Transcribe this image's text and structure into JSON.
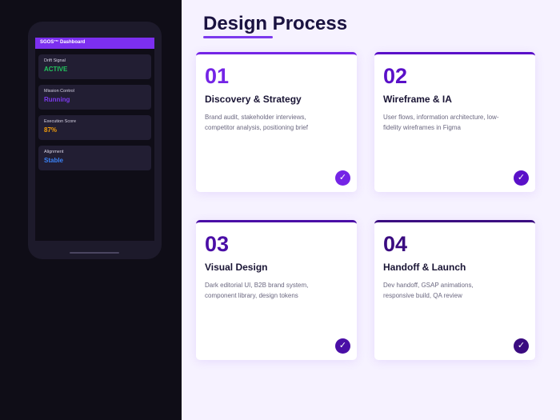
{
  "dashboard": {
    "title": "SGOS™ Dashboard",
    "stats": [
      {
        "label": "Drift Signal",
        "value": "ACTIVE",
        "color": "#22c55e"
      },
      {
        "label": "Mission Control",
        "value": "Running",
        "color": "#7c3aed"
      },
      {
        "label": "Execution Score",
        "value": "87%",
        "color": "#f59e0b"
      },
      {
        "label": "Alignment",
        "value": "Stable",
        "color": "#3b82f6"
      }
    ]
  },
  "heading": "Design Process",
  "cards": [
    {
      "number": "01",
      "title": "Discovery & Strategy",
      "desc": "Brand audit, stakeholder interviews, competitor analysis, positioning brief",
      "color": "#7424e6",
      "icon": "check-icon"
    },
    {
      "number": "02",
      "title": "Wireframe & IA",
      "desc": "User flows, information architecture, low-fidelity wireframes in Figma",
      "color": "#5a10c8",
      "icon": "check-icon"
    },
    {
      "number": "03",
      "title": "Visual Design",
      "desc": "Dark editorial UI, B2B brand system, component library, design tokens",
      "color": "#4a0ea6",
      "icon": "check-icon"
    },
    {
      "number": "04",
      "title": "Handoff & Launch",
      "desc": "Dev handoff, GSAP animations, responsive build, QA review",
      "color": "#3a0b80",
      "icon": "check-icon"
    }
  ]
}
